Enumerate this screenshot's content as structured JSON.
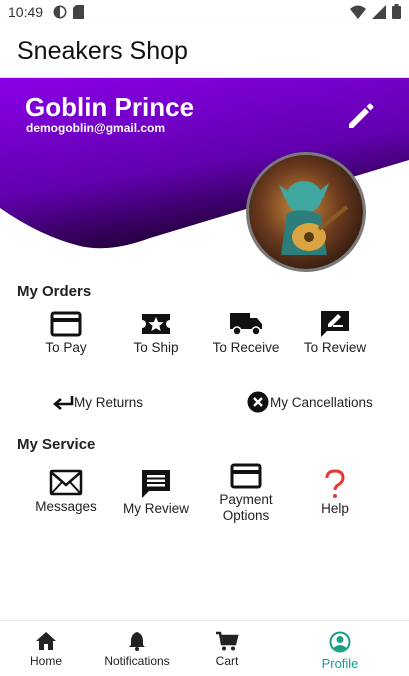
{
  "status_bar": {
    "time": "10:49"
  },
  "app_bar": {
    "title": "Sneakers Shop"
  },
  "profile": {
    "name": "Goblin Prince",
    "email": "demogoblin@gmail.com"
  },
  "orders": {
    "title": "My Orders",
    "items": [
      {
        "label": "To Pay",
        "icon": "credit-card-icon"
      },
      {
        "label": "To Ship",
        "icon": "ticket-star-icon"
      },
      {
        "label": "To Receive",
        "icon": "truck-icon"
      },
      {
        "label": "To Review",
        "icon": "rate-review-icon"
      }
    ],
    "returns_label": "My Returns",
    "cancellations_label": "My Cancellations"
  },
  "service": {
    "title": "My Service",
    "items": [
      {
        "label": "Messages",
        "icon": "envelope-icon"
      },
      {
        "label": "My Review",
        "icon": "comment-icon"
      },
      {
        "label": "Payment Options",
        "icon": "payment-card-icon"
      },
      {
        "label": "Help",
        "icon": "question-icon"
      }
    ]
  },
  "bottom_nav": {
    "items": [
      {
        "label": "Home",
        "icon": "home-icon"
      },
      {
        "label": "Notifications",
        "icon": "bell-icon"
      },
      {
        "label": "Cart",
        "icon": "cart-icon"
      },
      {
        "label": "Profile",
        "icon": "profile-icon",
        "active": true
      }
    ]
  },
  "colors": {
    "header_gradient_start": "#7b00d6",
    "header_gradient_end": "#2a0040",
    "active_nav": "#16a085",
    "help_red": "#e53935"
  }
}
